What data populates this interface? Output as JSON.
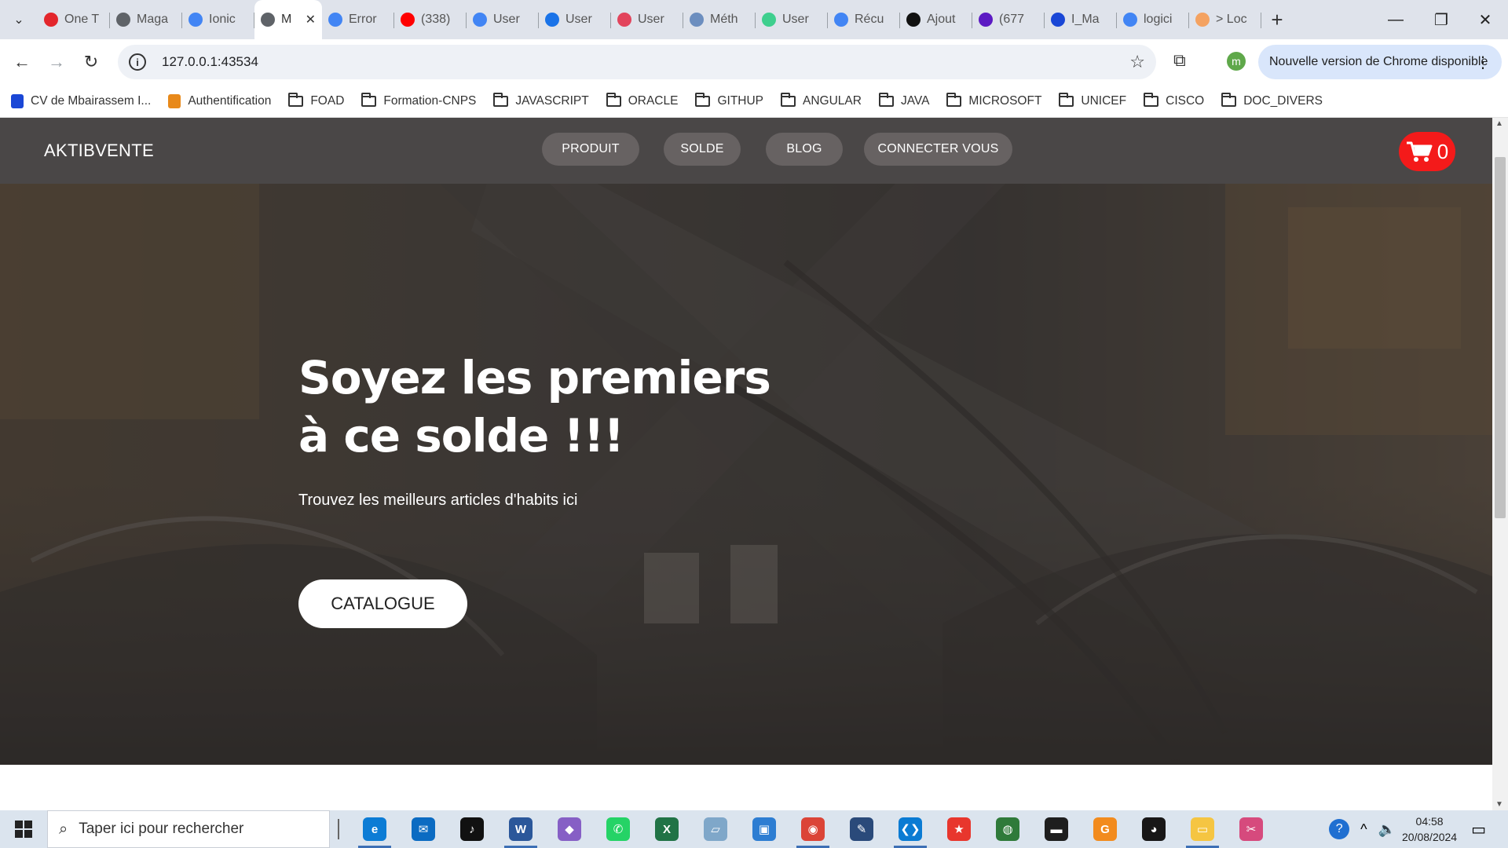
{
  "browser": {
    "tabs": [
      {
        "title": "One T",
        "color": "#e3262c"
      },
      {
        "title": "Maga",
        "color": "#5f6368"
      },
      {
        "title": "Ionic",
        "color": "#4285f4"
      },
      {
        "title": "M",
        "color": "#5f6368",
        "active": true
      },
      {
        "title": "Error",
        "color": "#4285f4"
      },
      {
        "title": "(338)",
        "color": "#ff0000"
      },
      {
        "title": "User",
        "color": "#4285f4"
      },
      {
        "title": "User",
        "color": "#1a73e8"
      },
      {
        "title": "User",
        "color": "#e2445c"
      },
      {
        "title": "Méth",
        "color": "#6c8ebf"
      },
      {
        "title": "User",
        "color": "#3ecf8e"
      },
      {
        "title": "Récu",
        "color": "#4285f4"
      },
      {
        "title": "Ajout",
        "color": "#111111"
      },
      {
        "title": "(677",
        "color": "#5c1ac3"
      },
      {
        "title": "I_Ma",
        "color": "#1a47d6"
      },
      {
        "title": "logici",
        "color": "#4285f4"
      },
      {
        "title": "> Loc",
        "color": "#f4a261"
      }
    ],
    "tab_close": "✕",
    "new_tab": "+",
    "window_controls": {
      "minimize": "—",
      "restore": "❐",
      "close": "✕"
    },
    "url": "127.0.0.1:43534",
    "profile_initial": "m",
    "update_chip": "Nouvelle version de Chrome disponible",
    "bookmarks": [
      {
        "label": "CV de Mbairassem I...",
        "icon": "doc-icon",
        "color": "#1a47d6"
      },
      {
        "label": "Authentification",
        "icon": "auth-icon",
        "color": "#e8891a"
      },
      {
        "label": "FOAD",
        "icon": "folder-icon"
      },
      {
        "label": "Formation-CNPS",
        "icon": "folder-icon"
      },
      {
        "label": "JAVASCRIPT",
        "icon": "folder-icon"
      },
      {
        "label": "ORACLE",
        "icon": "folder-icon"
      },
      {
        "label": "GITHUP",
        "icon": "folder-icon"
      },
      {
        "label": "ANGULAR",
        "icon": "folder-icon"
      },
      {
        "label": "JAVA",
        "icon": "folder-icon"
      },
      {
        "label": "MICROSOFT",
        "icon": "folder-icon"
      },
      {
        "label": "UNICEF",
        "icon": "folder-icon"
      },
      {
        "label": "CISCO",
        "icon": "folder-icon"
      },
      {
        "label": "DOC_DIVERS",
        "icon": "folder-icon"
      }
    ]
  },
  "site": {
    "brand": "AKTIBVENTE",
    "nav": {
      "produit": "PRODUIT",
      "solde": "SOLDE",
      "blog": "BLOG",
      "connect": "CONNECTER VOUS"
    },
    "cart_count": "0",
    "cart_color": "#f41a1a",
    "hero": {
      "title_line1": "Soyez les premiers",
      "title_line2": "à ce solde !!!",
      "subtitle": "Trouvez les meilleurs articles d'habits ici",
      "cta": "CATALOGUE"
    }
  },
  "taskbar": {
    "search_placeholder": "Taper ici pour rechercher",
    "apps": [
      {
        "name": "edge-icon",
        "color": "#0c7cd5",
        "glyph": "e",
        "running": true
      },
      {
        "name": "mail-icon",
        "color": "#0b6bc2",
        "glyph": "✉",
        "running": false
      },
      {
        "name": "tiktok-icon",
        "color": "#111111",
        "glyph": "♪",
        "running": false
      },
      {
        "name": "word-icon",
        "color": "#2b579a",
        "glyph": "W",
        "running": true
      },
      {
        "name": "visual-studio-icon",
        "color": "#865fc5",
        "glyph": "◆",
        "running": false
      },
      {
        "name": "whatsapp-icon",
        "color": "#25d366",
        "glyph": "✆",
        "running": false
      },
      {
        "name": "excel-icon",
        "color": "#217346",
        "glyph": "X",
        "running": false
      },
      {
        "name": "notes-icon",
        "color": "#7fa7c9",
        "glyph": "▱",
        "running": false
      },
      {
        "name": "remote-desktop-icon",
        "color": "#2d7dd2",
        "glyph": "▣",
        "running": false
      },
      {
        "name": "chrome-icon",
        "color": "#db4437",
        "glyph": "◉",
        "running": true
      },
      {
        "name": "sql-server-icon",
        "color": "#2a4a7a",
        "glyph": "✎",
        "running": false
      },
      {
        "name": "vscode-icon",
        "color": "#0a7bd3",
        "glyph": "❮❯",
        "running": true
      },
      {
        "name": "star-app-icon",
        "color": "#e8362d",
        "glyph": "★",
        "running": false
      },
      {
        "name": "globe-app-icon",
        "color": "#2f7a3a",
        "glyph": "◍",
        "running": false
      },
      {
        "name": "terminal-icon",
        "color": "#1e1e1e",
        "glyph": "▬",
        "running": false
      },
      {
        "name": "pdf-app-icon",
        "color": "#f28b1e",
        "glyph": "G",
        "running": false
      },
      {
        "name": "github-icon",
        "color": "#181717",
        "glyph": "◕",
        "running": false
      },
      {
        "name": "file-explorer-icon",
        "color": "#f5c542",
        "glyph": "▭",
        "running": true
      },
      {
        "name": "snipping-tool-icon",
        "color": "#d64a7d",
        "glyph": "✂",
        "running": false
      }
    ],
    "time": "04:58",
    "date": "20/08/2024"
  }
}
